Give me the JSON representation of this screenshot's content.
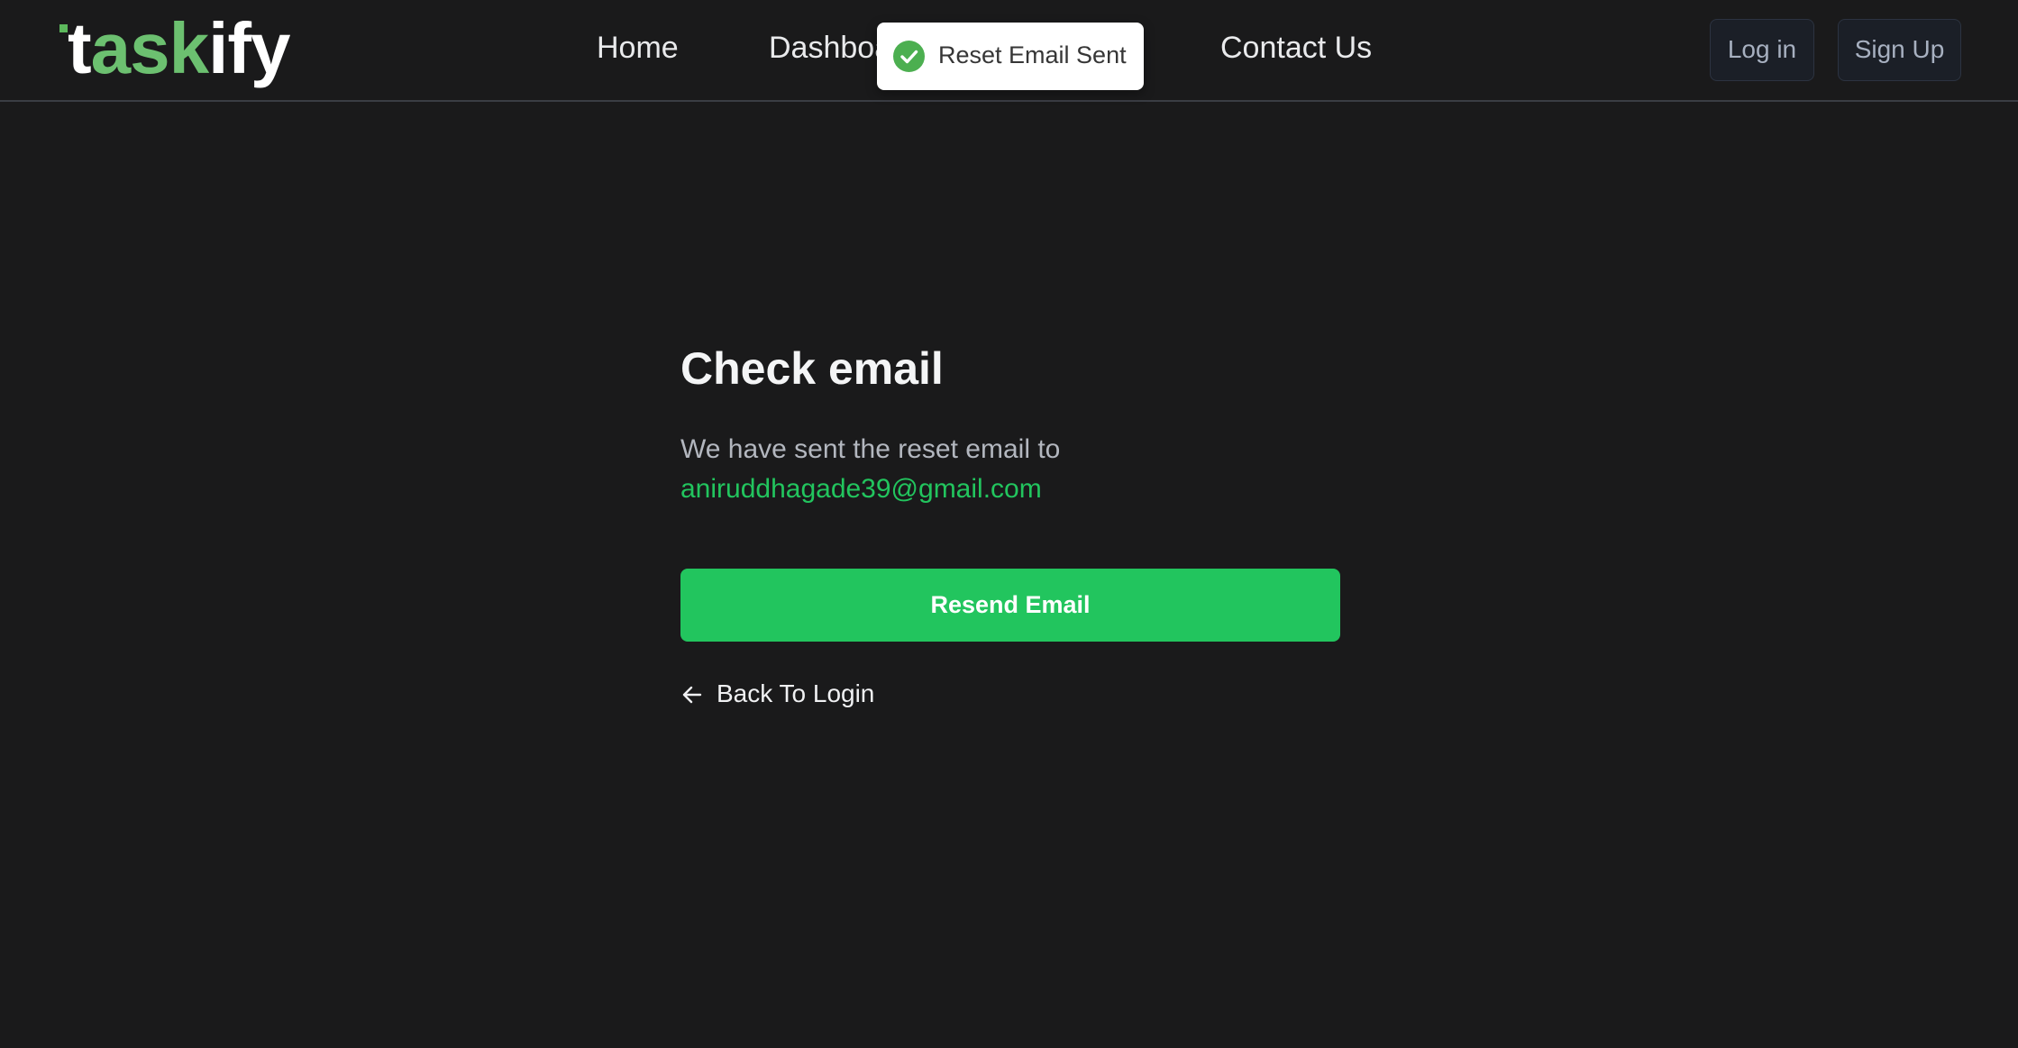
{
  "brand": {
    "logo_t": "t",
    "logo_ask": "ask",
    "logo_ify": "ify",
    "accent_color": "#6cc070"
  },
  "nav": {
    "links": [
      {
        "label": "Home"
      },
      {
        "label": "Dashboard"
      },
      {
        "label": "Contact Us"
      }
    ],
    "login_label": "Log in",
    "signup_label": "Sign Up"
  },
  "toast": {
    "message": "Reset Email Sent",
    "icon": "check-circle-icon",
    "icon_color": "#4caf50"
  },
  "main": {
    "title": "Check email",
    "subtitle": "We have sent the reset email to",
    "email": "aniruddhagade39@gmail.com",
    "email_color": "#22c55e",
    "resend_label": "Resend Email",
    "back_label": "Back To Login",
    "back_icon": "arrow-left-icon"
  }
}
